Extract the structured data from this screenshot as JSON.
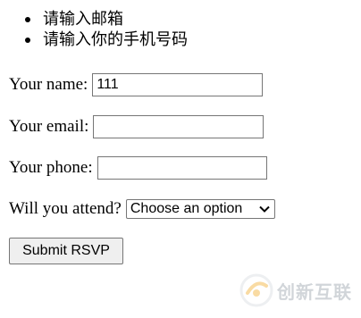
{
  "errors": [
    "请输入邮箱",
    "请输入你的手机号码"
  ],
  "form": {
    "name": {
      "label": "Your name:",
      "value": "111"
    },
    "email": {
      "label": "Your email:",
      "value": ""
    },
    "phone": {
      "label": "Your phone:",
      "value": ""
    },
    "attend": {
      "label": "Will you attend?",
      "selected": "Choose an option"
    },
    "submit_label": "Submit RSVP"
  },
  "watermark": {
    "text": "创新互联",
    "logo": "brand-logo-icon"
  }
}
